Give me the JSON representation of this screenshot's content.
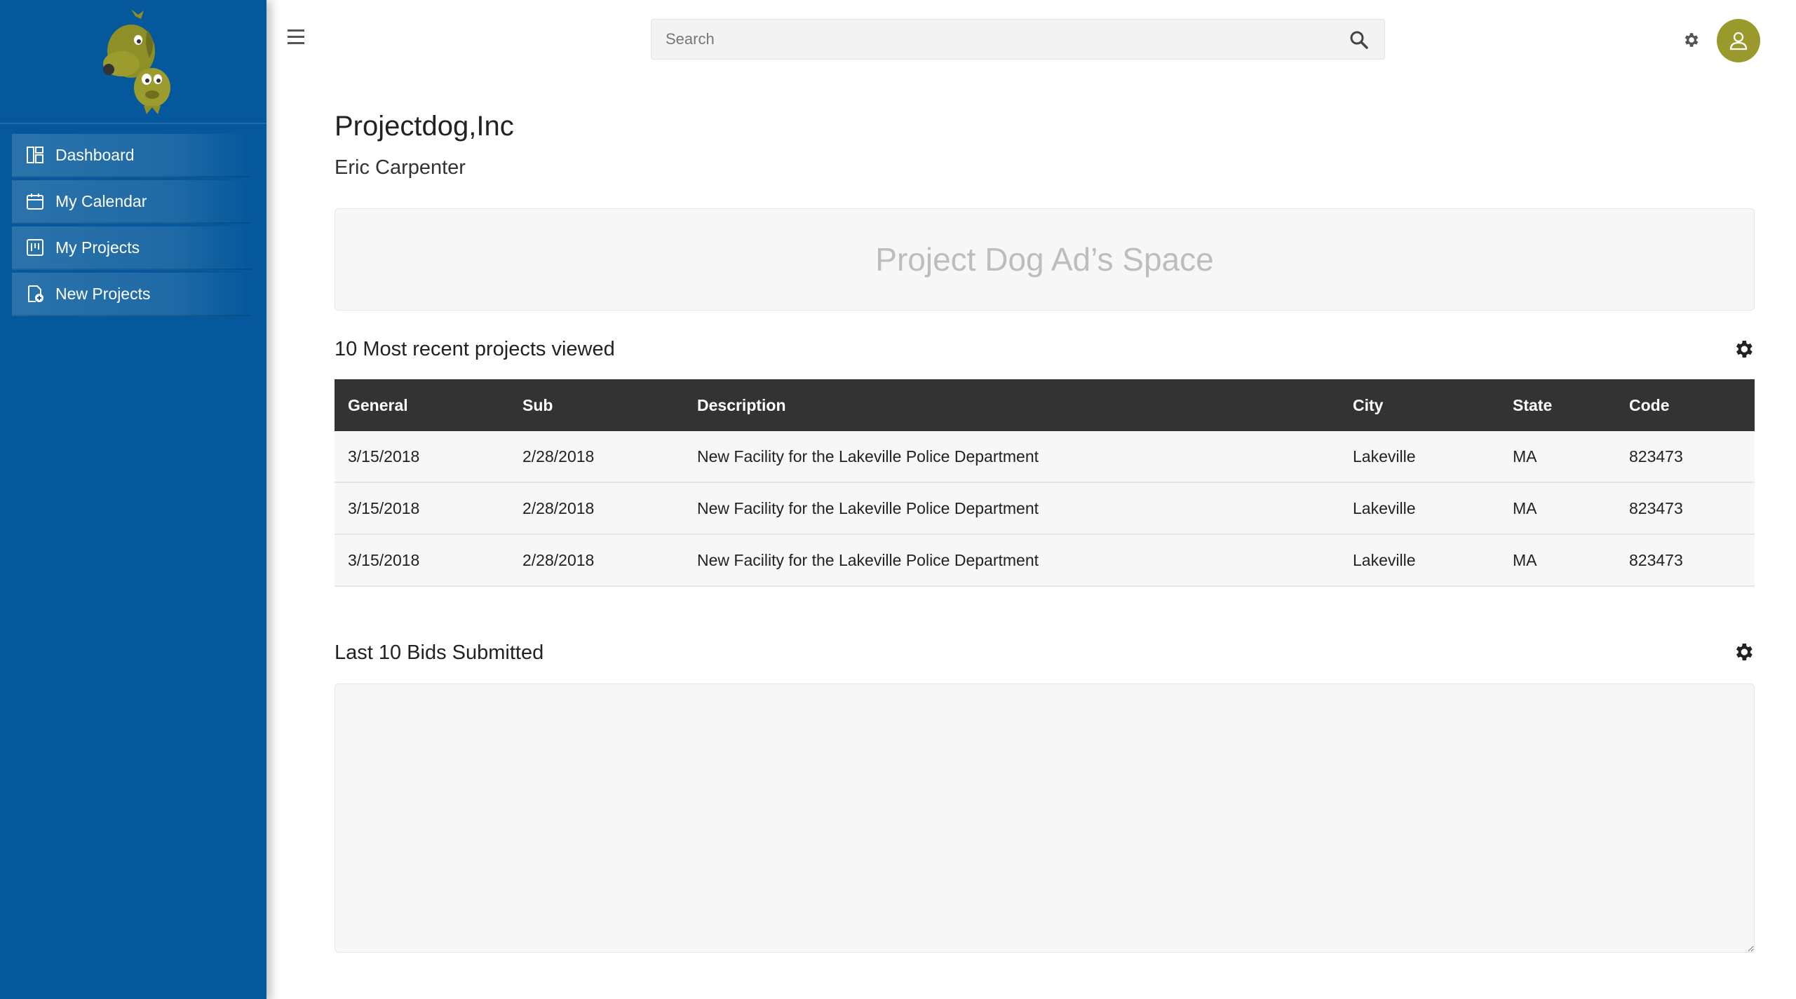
{
  "sidebar": {
    "items": [
      {
        "label": "Dashboard",
        "icon": "dashboard-icon"
      },
      {
        "label": "My Calendar",
        "icon": "calendar-icon"
      },
      {
        "label": "My Projects",
        "icon": "projects-icon"
      },
      {
        "label": "New Projects",
        "icon": "new-projects-icon"
      }
    ],
    "color": "#04589b"
  },
  "header": {
    "search_placeholder": "Search",
    "avatar_color": "#9a9a2c"
  },
  "main": {
    "company": "Projectdog,Inc",
    "user": "Eric Carpenter",
    "ad_text": "Project Dog Ad’s Space",
    "recent": {
      "title": "10 Most recent projects viewed",
      "columns": [
        "General",
        "Sub",
        "Description",
        "City",
        "State",
        "Code"
      ],
      "rows": [
        [
          "3/15/2018",
          "2/28/2018",
          "New Facility for the Lakeville Police Department",
          "Lakeville",
          "MA",
          "823473"
        ],
        [
          "3/15/2018",
          "2/28/2018",
          "New Facility for the Lakeville Police Department",
          "Lakeville",
          "MA",
          "823473"
        ],
        [
          "3/15/2018",
          "2/28/2018",
          "New Facility for the Lakeville Police Department",
          "Lakeville",
          "MA",
          "823473"
        ]
      ]
    },
    "bids": {
      "title": "Last 10 Bids Submitted"
    }
  }
}
